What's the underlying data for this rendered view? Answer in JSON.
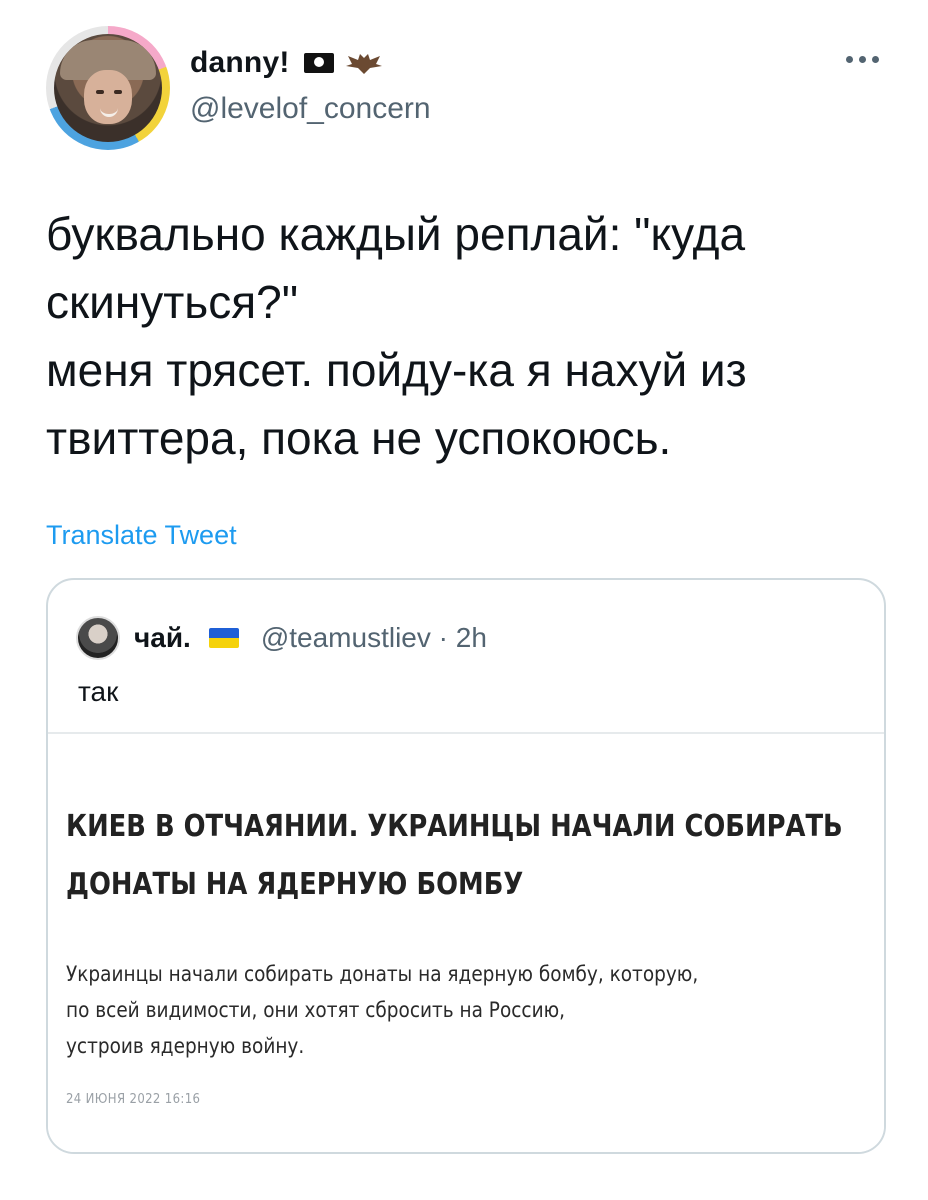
{
  "author": {
    "display_name": "danny!",
    "handle": "@levelof_concern",
    "name_emojis": [
      "pirate-flag-icon",
      "bat-icon"
    ]
  },
  "tweet": {
    "text": "буквально каждый реплай: \"куда\nскинуться?\"\nменя трясет. пойду-ка я нахуй из\nтвиттера, пока не успокоюсь.",
    "translate_label": "Translate Tweet"
  },
  "quoted_tweet": {
    "display_name": "чай.",
    "flag": "ukraine-flag-icon",
    "handle_time": "@teamustliev · 2h",
    "text": "так",
    "article": {
      "headline_lines": [
        "КИЕВ В ОТЧАЯНИИ. УКРАИНЦЫ НАЧАЛИ СОБИРАТЬ",
        "ДОНАТЫ НА  ЯДЕРНУЮ БОМБУ"
      ],
      "lead_lines": [
        "Украинцы начали собирать донаты на ядерную бомбу, которую,",
        "по всей видимости, они хотят сбросить на Россию,",
        "устроив ядерную войну."
      ],
      "date": "24 ИЮНЯ 2022 16:16"
    }
  },
  "colors": {
    "link": "#1d9bf0",
    "secondary_text": "#536471",
    "border": "#cfd9de"
  }
}
